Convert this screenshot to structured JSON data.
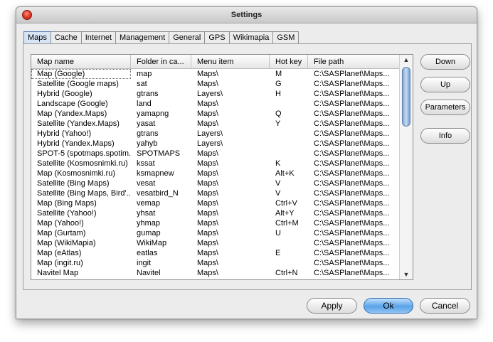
{
  "window": {
    "title": "Settings"
  },
  "tabs": [
    {
      "label": "Maps"
    },
    {
      "label": "Cache"
    },
    {
      "label": "Internet"
    },
    {
      "label": "Management"
    },
    {
      "label": "General"
    },
    {
      "label": "GPS"
    },
    {
      "label": "Wikimapia"
    },
    {
      "label": "GSM"
    }
  ],
  "list": {
    "columns": [
      "Map name",
      "Folder in ca...",
      "Menu item",
      "Hot key",
      "File path"
    ],
    "rows": [
      [
        "Map (Google)",
        "map",
        "Maps\\",
        "M",
        "C:\\SASPlanet\\Maps..."
      ],
      [
        "Satellite (Google maps)",
        "sat",
        "Maps\\",
        "G",
        "C:\\SASPlanet\\Maps..."
      ],
      [
        "Hybrid (Google)",
        "gtrans",
        "Layers\\",
        "H",
        "C:\\SASPlanet\\Maps..."
      ],
      [
        "Landscape (Google)",
        "land",
        "Maps\\",
        "",
        "C:\\SASPlanet\\Maps..."
      ],
      [
        "Map (Yandex.Maps)",
        "yamapng",
        "Maps\\",
        "Q",
        "C:\\SASPlanet\\Maps..."
      ],
      [
        "Satellite (Yandex.Maps)",
        "yasat",
        "Maps\\",
        "Y",
        "C:\\SASPlanet\\Maps..."
      ],
      [
        "Hybrid (Yahoo!)",
        "gtrans",
        "Layers\\",
        "",
        "C:\\SASPlanet\\Maps..."
      ],
      [
        "Hybrid (Yandex.Maps)",
        "yahyb",
        "Layers\\",
        "",
        "C:\\SASPlanet\\Maps..."
      ],
      [
        "SPOT-5 (spotmaps.spotim...",
        "SPOTMAPS",
        "Maps\\",
        "",
        "C:\\SASPlanet\\Maps..."
      ],
      [
        "Satellite (Kosmosnimki.ru)",
        "kssat",
        "Maps\\",
        "K",
        "C:\\SASPlanet\\Maps..."
      ],
      [
        "Map (Kosmosnimki.ru)",
        "ksmapnew",
        "Maps\\",
        "Alt+K",
        "C:\\SASPlanet\\Maps..."
      ],
      [
        "Satellite (Bing Maps)",
        "vesat",
        "Maps\\",
        "V",
        "C:\\SASPlanet\\Maps..."
      ],
      [
        "Satellite (Bing Maps, Bird'...",
        "vesatbird_N",
        "Maps\\",
        "V",
        "C:\\SASPlanet\\Maps..."
      ],
      [
        "Map (Bing Maps)",
        "vemap",
        "Maps\\",
        "Ctrl+V",
        "C:\\SASPlanet\\Maps..."
      ],
      [
        "Satellite (Yahoo!)",
        "yhsat",
        "Maps\\",
        "Alt+Y",
        "C:\\SASPlanet\\Maps..."
      ],
      [
        "Map (Yahoo!)",
        "yhmap",
        "Maps\\",
        "Ctrl+M",
        "C:\\SASPlanet\\Maps..."
      ],
      [
        "Map (Gurtam)",
        "gumap",
        "Maps\\",
        "U",
        "C:\\SASPlanet\\Maps..."
      ],
      [
        "Map (WikiMapia)",
        "WikiMap",
        "Maps\\",
        "",
        "C:\\SASPlanet\\Maps..."
      ],
      [
        "Map (eAtlas)",
        "eatlas",
        "Maps\\",
        "E",
        "C:\\SASPlanet\\Maps..."
      ],
      [
        "Map (ingit.ru)",
        "ingit",
        "Maps\\",
        "",
        "C:\\SASPlanet\\Maps..."
      ],
      [
        "Navitel Map",
        "Navitel",
        "Maps\\",
        "Ctrl+N",
        "C:\\SASPlanet\\Maps..."
      ]
    ]
  },
  "side_buttons": {
    "down": "Down",
    "up": "Up",
    "parameters": "Parameters",
    "info": "Info"
  },
  "dialog_buttons": {
    "apply": "Apply",
    "ok": "Ok",
    "cancel": "Cancel"
  },
  "colors": {
    "accent": "#5aa3e8",
    "active_tab": "#d6e4f5",
    "close_button": "#e0402c"
  },
  "scrollbar": {
    "up_icon": "▲",
    "down_icon": "▼"
  }
}
